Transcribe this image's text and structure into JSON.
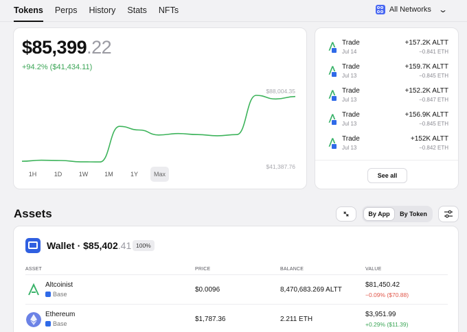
{
  "nav": {
    "tabs": [
      "Tokens",
      "Perps",
      "History",
      "Stats",
      "NFTs"
    ],
    "active_tab": "Tokens",
    "network_label": "All Networks"
  },
  "portfolio": {
    "balance_main": "$85,399",
    "balance_decimals": ".22",
    "change": "+94.2% ($41,434.11)",
    "chart_max_label": "$88,004.35",
    "chart_min_label": "$41,387.76",
    "ranges": [
      "1H",
      "1D",
      "1W",
      "1M",
      "1Y",
      "Max"
    ],
    "active_range": "Max"
  },
  "chart_data": {
    "type": "line",
    "y": [
      42300,
      43000,
      42800,
      41900,
      41800,
      66500,
      64000,
      60500,
      61500,
      60800,
      60000,
      60800,
      88000,
      85500,
      87200
    ],
    "ylim": [
      41387.76,
      88004.35
    ],
    "color": "#3cb35a"
  },
  "trades": [
    {
      "title": "Trade",
      "date": "Jul 14",
      "amount": "+157.2K ALTT",
      "eth": "−0.841 ETH"
    },
    {
      "title": "Trade",
      "date": "Jul 13",
      "amount": "+159.7K ALTT",
      "eth": "−0.845 ETH"
    },
    {
      "title": "Trade",
      "date": "Jul 13",
      "amount": "+152.2K ALTT",
      "eth": "−0.847 ETH"
    },
    {
      "title": "Trade",
      "date": "Jul 13",
      "amount": "+156.9K ALTT",
      "eth": "−0.845 ETH"
    },
    {
      "title": "Trade",
      "date": "Jul 13",
      "amount": "+152K ALTT",
      "eth": "−0.842 ETH"
    }
  ],
  "see_all_label": "See all",
  "assets": {
    "title": "Assets",
    "by_app": "By App",
    "by_token": "By Token",
    "active_view": "By App"
  },
  "wallet": {
    "name_main": "Wallet · $85,402",
    "name_decimals": ".41",
    "pct": "100%",
    "columns": [
      "ASSET",
      "PRICE",
      "BALANCE",
      "VALUE"
    ],
    "rows": [
      {
        "name": "Altcoinist",
        "chain": "Base",
        "price": "$0.0096",
        "balance": "8,470,683.269 ALTT",
        "value": "$81,450.42",
        "change": "−0.09% ($70.88)",
        "change_dir": "neg"
      },
      {
        "name": "Ethereum",
        "chain": "Base",
        "price": "$1,787.36",
        "balance": "2.211 ETH",
        "value": "$3,951.99",
        "change": "+0.29% ($11.39)",
        "change_dir": "pos"
      }
    ]
  },
  "colors": {
    "accent_green": "#3aa555",
    "accent_blue": "#2f6ae8",
    "negative": "#e05548"
  }
}
